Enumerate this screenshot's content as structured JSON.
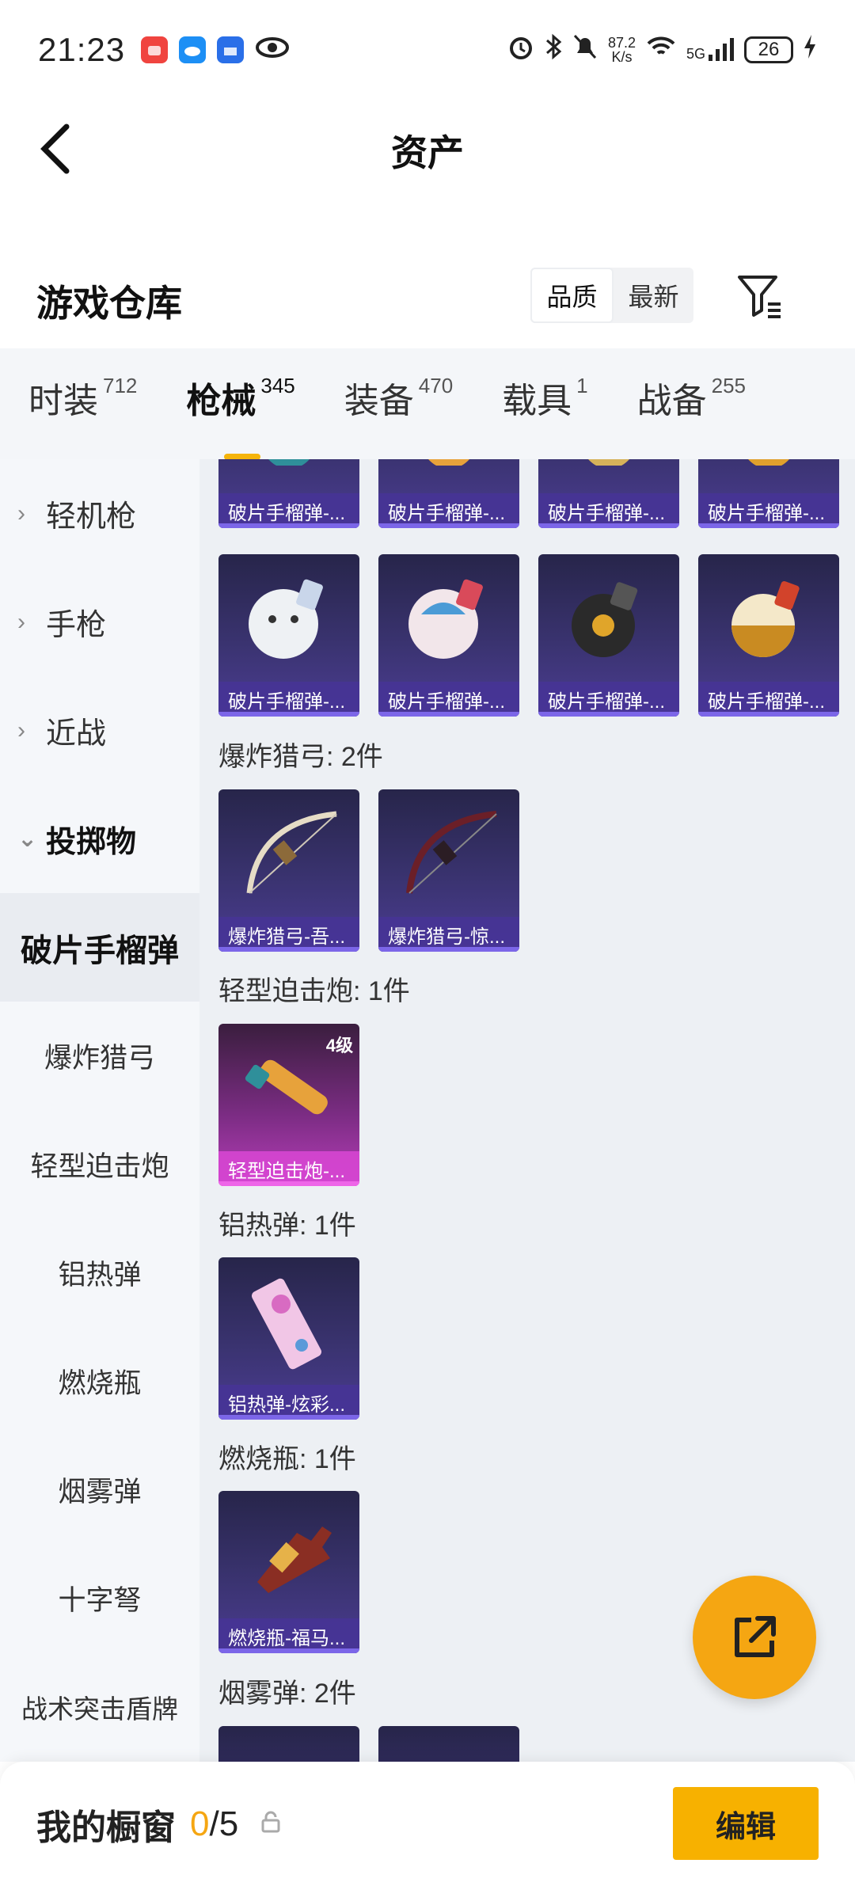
{
  "status_bar": {
    "time": "21:23",
    "net_speed_value": "87.2",
    "net_speed_unit": "K/s",
    "network": "5G",
    "battery": "26",
    "icons": [
      "red-app-icon",
      "cloud-app-icon",
      "store-app-icon",
      "eye-icon",
      "alarm-icon",
      "bluetooth-icon",
      "mute-icon",
      "wifi-icon",
      "signal-icon",
      "charging-icon"
    ]
  },
  "header": {
    "title": "资产"
  },
  "section": {
    "title": "游戏仓库",
    "sort_quality": "品质",
    "sort_newest": "最新"
  },
  "tabs": [
    {
      "label": "时装",
      "count": "712"
    },
    {
      "label": "枪械",
      "count": "345"
    },
    {
      "label": "装备",
      "count": "470"
    },
    {
      "label": "载具",
      "count": "1"
    },
    {
      "label": "战备",
      "count": "255"
    }
  ],
  "sidebar": {
    "groups": [
      "轻机枪",
      "手枪",
      "近战",
      "投掷物"
    ],
    "subitems": [
      "破片手榴弹",
      "爆炸猎弓",
      "轻型迫击炮",
      "铝热弹",
      "燃烧瓶",
      "烟雾弹",
      "十字弩",
      "战术突击盾牌"
    ]
  },
  "content": {
    "row1_captions": [
      "破片手榴弹-...",
      "破片手榴弹-...",
      "破片手榴弹-...",
      "破片手榴弹-..."
    ],
    "row2_captions": [
      "破片手榴弹-...",
      "破片手榴弹-...",
      "破片手榴弹-...",
      "破片手榴弹-..."
    ],
    "group_bow": {
      "label": "爆炸猎弓: 2件",
      "captions": [
        "爆炸猎弓-吾...",
        "爆炸猎弓-惊..."
      ]
    },
    "group_mortar": {
      "label": "轻型迫击炮: 1件",
      "captions": [
        "轻型迫击炮-..."
      ],
      "level": "4级"
    },
    "group_thermite": {
      "label": "铝热弹: 1件",
      "captions": [
        "铝热弹-炫彩..."
      ]
    },
    "group_molotov": {
      "label": "燃烧瓶: 1件",
      "captions": [
        "燃烧瓶-福马..."
      ]
    },
    "group_smoke": {
      "label": "烟雾弹: 2件"
    }
  },
  "bottom_bar": {
    "title": "我的橱窗",
    "count_current": "0",
    "count_total": "/5",
    "edit_label": "编辑"
  },
  "colors": {
    "accent": "#f5b40b",
    "card_purple": "#4b3c92",
    "card_pink": "#b63db8"
  }
}
